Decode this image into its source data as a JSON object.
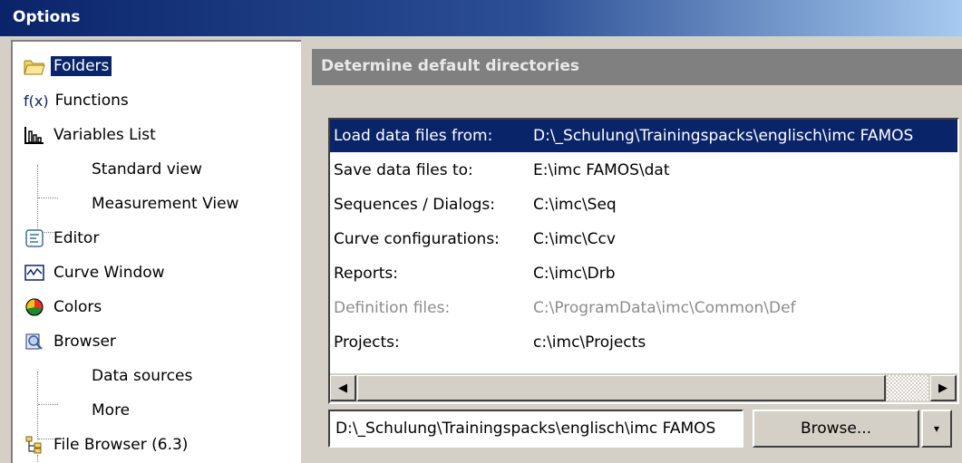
{
  "window": {
    "title": "Options"
  },
  "tree": {
    "items": [
      {
        "label": "Folders",
        "icon": "folder-icon",
        "selected": true
      },
      {
        "label": "Functions",
        "icon": "function-fx-icon"
      },
      {
        "label": "Variables List",
        "icon": "variables-list-icon"
      },
      {
        "label": "Standard view"
      },
      {
        "label": "Measurement View"
      },
      {
        "label": "Editor",
        "icon": "editor-icon"
      },
      {
        "label": "Curve Window",
        "icon": "curve-window-icon"
      },
      {
        "label": "Colors",
        "icon": "colors-icon"
      },
      {
        "label": "Browser",
        "icon": "browser-icon"
      },
      {
        "label": "Data sources"
      },
      {
        "label": "More"
      },
      {
        "label": "File Browser (6.3)",
        "icon": "file-browser-icon"
      }
    ],
    "fx_glyph": "f(x)"
  },
  "main": {
    "header": "Determine default directories",
    "directories": [
      {
        "label": "Load data files from:",
        "path": "D:\\_Schulung\\Trainingspacks\\englisch\\imc FAMOS",
        "selected": true
      },
      {
        "label": "Save data files to:",
        "path": "E:\\imc FAMOS\\dat"
      },
      {
        "label": "Sequences / Dialogs:",
        "path": "C:\\imc\\Seq"
      },
      {
        "label": "Curve configurations:",
        "path": "C:\\imc\\Ccv"
      },
      {
        "label": "Reports:",
        "path": "C:\\imc\\Drb"
      },
      {
        "label": "Definition files:",
        "path": "C:\\ProgramData\\imc\\Common\\Def",
        "disabled": true
      },
      {
        "label": "Projects:",
        "path": "c:\\imc\\Projects"
      }
    ],
    "path_input_value": "D:\\_Schulung\\Trainingspacks\\englisch\\imc FAMOS",
    "browse_label": "Browse...",
    "dropdown_arrow": "▾",
    "scroll_left": "◀",
    "scroll_right": "▶"
  },
  "colors": {
    "selection": "#0a246a",
    "title_gradient_start": "#0a246a",
    "title_gradient_end": "#a6caf0",
    "header_band": "#808080",
    "disabled_text": "#8c8c8c"
  }
}
